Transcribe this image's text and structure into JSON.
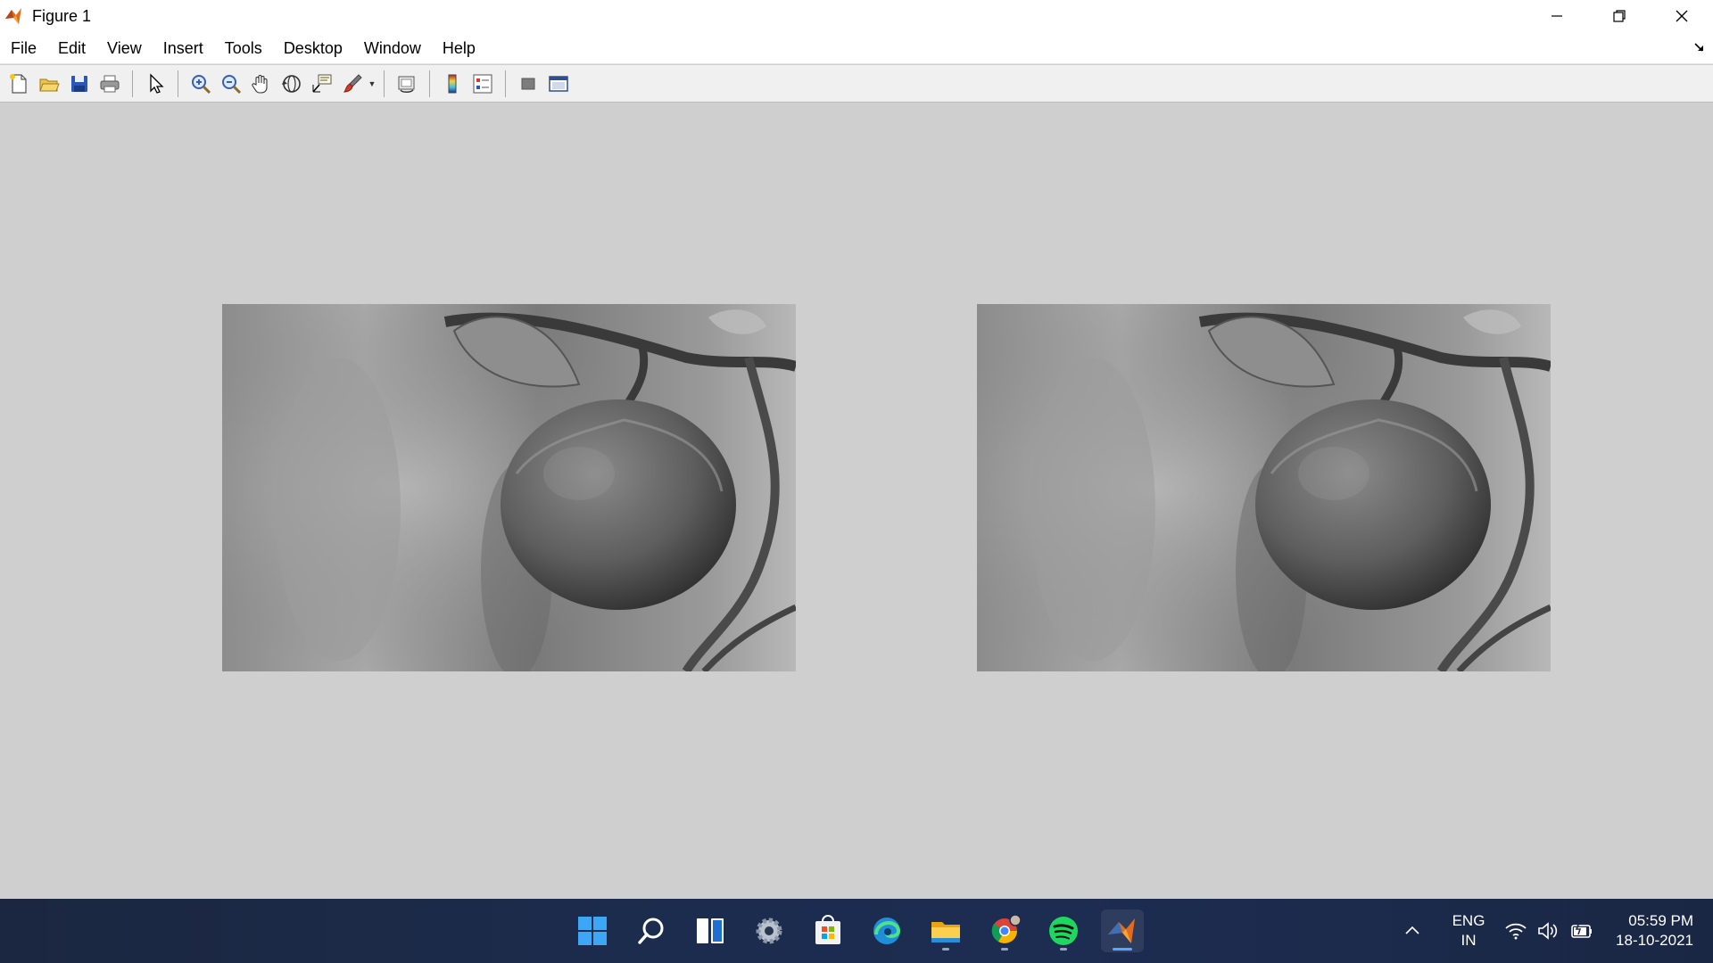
{
  "window": {
    "title": "Figure 1"
  },
  "menu": {
    "items": [
      "File",
      "Edit",
      "View",
      "Insert",
      "Tools",
      "Desktop",
      "Window",
      "Help"
    ]
  },
  "toolbar": {
    "buttons": [
      "new-figure",
      "open-file",
      "save",
      "print",
      "edit-plot",
      "zoom-in",
      "zoom-out",
      "pan",
      "rotate-3d",
      "data-cursor",
      "brush",
      "link-plot",
      "colorbar",
      "legend",
      "hide-plot-tools",
      "show-plot-tools"
    ]
  },
  "figure": {
    "axes": [
      {
        "content": "grayscale apple image"
      },
      {
        "content": "grayscale apple image"
      }
    ]
  },
  "taskbar": {
    "apps": [
      "start",
      "search",
      "widgets",
      "settings",
      "store",
      "edge",
      "file-explorer",
      "chrome",
      "spotify",
      "matlab"
    ],
    "language": {
      "line1": "ENG",
      "line2": "IN"
    },
    "clock": {
      "time": "05:59 PM",
      "date": "18-10-2021"
    }
  },
  "colors": {
    "figure_bg": "#cfcfcf",
    "taskbar": "#1c2c4e",
    "accent": "#5aa5ff"
  }
}
